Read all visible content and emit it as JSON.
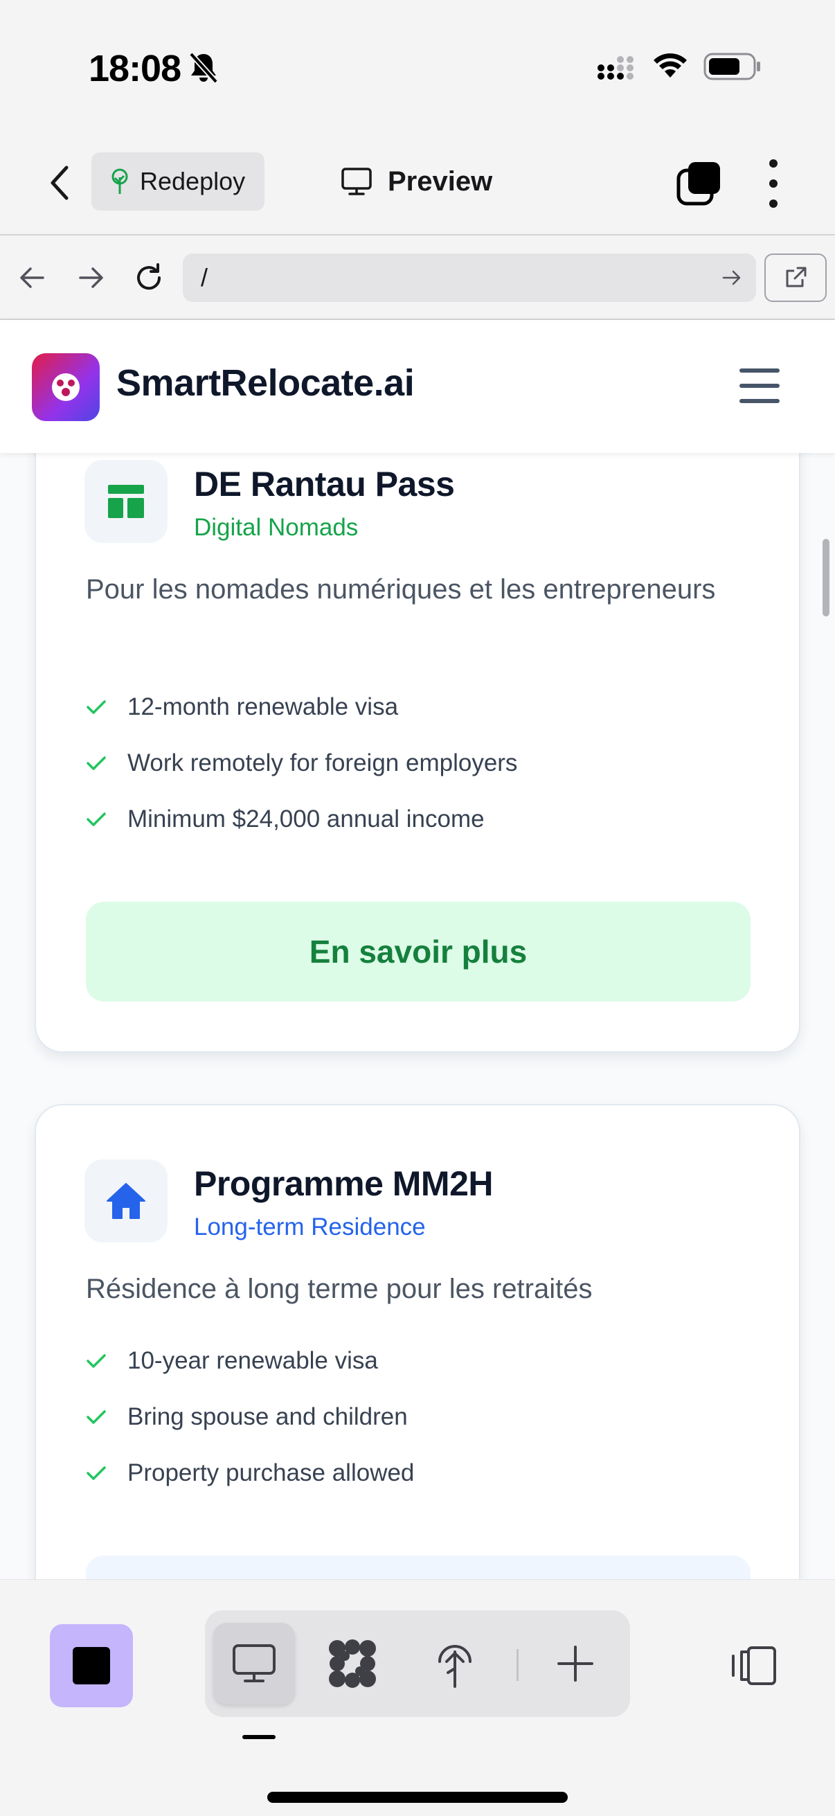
{
  "status_bar": {
    "time": "18:08"
  },
  "toolbar": {
    "redeploy_label": "Redeploy",
    "preview_label": "Preview"
  },
  "url_bar": {
    "value": "/"
  },
  "site_header": {
    "name": "SmartRelocate.ai"
  },
  "cards": [
    {
      "title": "DE Rantau Pass",
      "tag": "Digital Nomads",
      "description": "Pour les nomades numériques et les entrepreneurs",
      "features": [
        "12-month renewable visa",
        "Work remotely for foreign employers",
        "Minimum $24,000 annual income"
      ],
      "cta": "En savoir plus",
      "icon": "layout-grid-icon",
      "accent": "#16a34a"
    },
    {
      "title": "Programme MM2H",
      "tag": "Long-term Residence",
      "description": "Résidence à long terme pour les retraités",
      "features": [
        "10-year renewable visa",
        "Bring spouse and children",
        "Property purchase allowed"
      ],
      "icon": "home-icon",
      "accent": "#2563eb"
    }
  ],
  "colors": {
    "check": "#22c55e",
    "stop_button": "#c4b5fd"
  }
}
